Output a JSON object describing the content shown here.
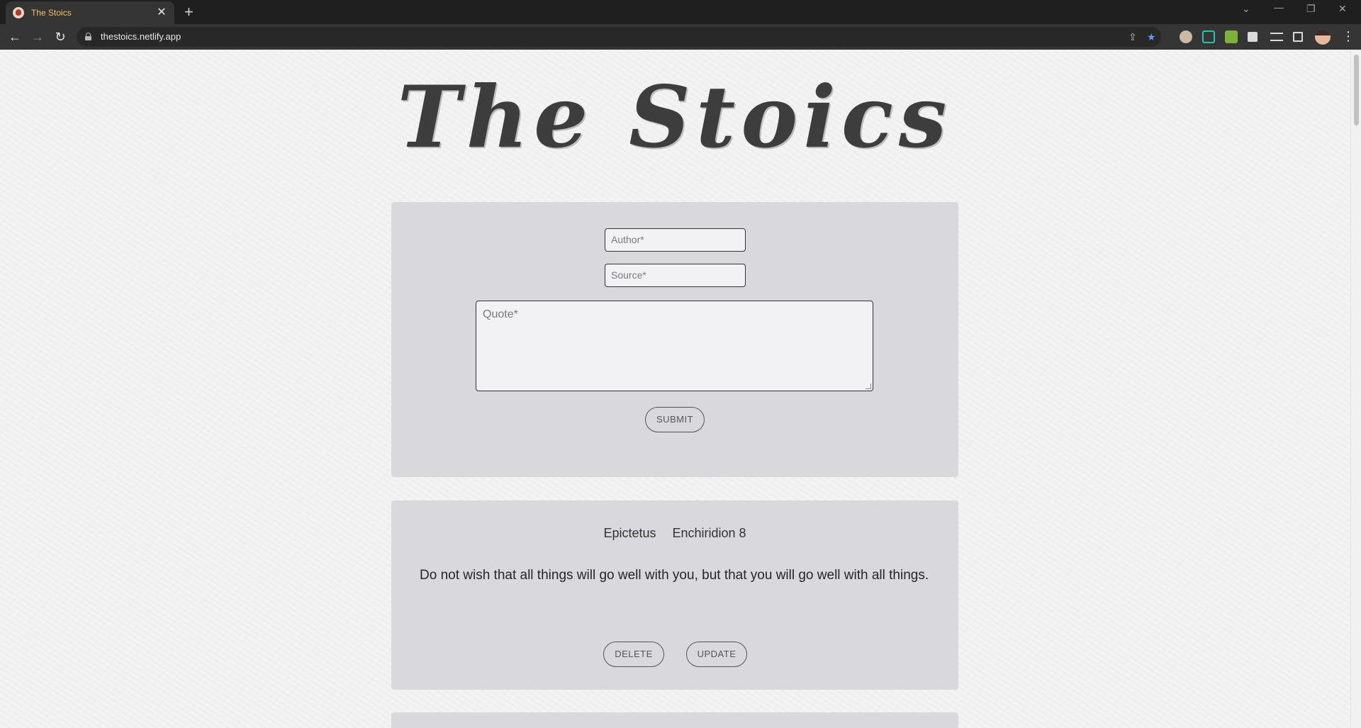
{
  "browser": {
    "tab_title": "The Stoics",
    "url": "thestoics.netlify.app",
    "new_tab_glyph": "+",
    "close_glyph": "✕"
  },
  "page": {
    "title": "The Stoics",
    "form": {
      "author_placeholder": "Author*",
      "source_placeholder": "Source*",
      "quote_placeholder": "Quote*",
      "submit_label": "SUBMIT"
    },
    "quotes": [
      {
        "author": "Epictetus",
        "source": "Enchiridion 8",
        "text": "Do not wish that all things will go well with you, but that you will go well with all things.",
        "delete_label": "DELETE",
        "update_label": "UPDATE"
      }
    ]
  },
  "colors": {
    "card_bg": "#d8d8dd",
    "chrome_bg": "#1f1f1f",
    "toolbar_bg": "#353535",
    "tab_title_color": "#f0c06a"
  }
}
